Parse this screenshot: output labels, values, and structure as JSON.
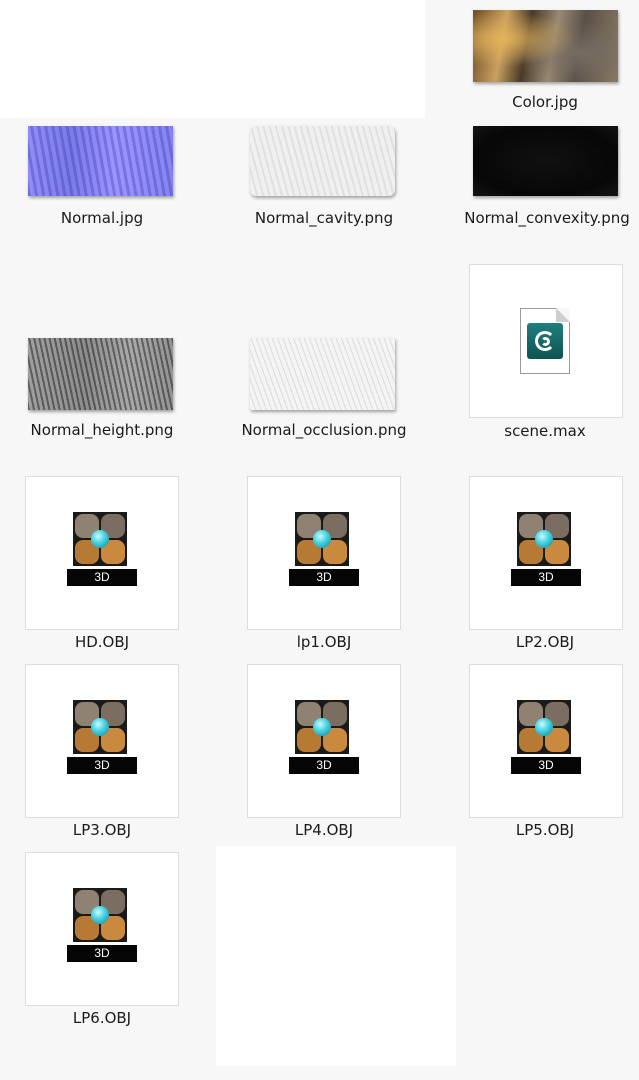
{
  "files": [
    {
      "id": "color",
      "name": "Color.jpg",
      "kind": "image-thumbnail",
      "thumb": "cave-texture"
    },
    {
      "id": "normal",
      "name": "Normal.jpg",
      "kind": "image-thumbnail",
      "thumb": "normal-map"
    },
    {
      "id": "cavity",
      "name": "Normal_cavity.png",
      "kind": "image-thumbnail",
      "thumb": "cavity-map"
    },
    {
      "id": "convexity",
      "name": "Normal_convexity.png",
      "kind": "image-thumbnail",
      "thumb": "convexity-map"
    },
    {
      "id": "height",
      "name": "Normal_height.png",
      "kind": "image-thumbnail",
      "thumb": "height-map"
    },
    {
      "id": "occlusion",
      "name": "Normal_occlusion.png",
      "kind": "image-thumbnail",
      "thumb": "occlusion-map"
    },
    {
      "id": "scene",
      "name": "scene.max",
      "kind": "file-icon",
      "icon": "3ds-max-file-icon"
    },
    {
      "id": "hd",
      "name": "HD.OBJ",
      "kind": "file-icon",
      "icon": "obj-3d-file-icon",
      "badge": "3D"
    },
    {
      "id": "lp1",
      "name": "lp1.OBJ",
      "kind": "file-icon",
      "icon": "obj-3d-file-icon",
      "badge": "3D"
    },
    {
      "id": "lp2",
      "name": "LP2.OBJ",
      "kind": "file-icon",
      "icon": "obj-3d-file-icon",
      "badge": "3D"
    },
    {
      "id": "lp3",
      "name": "LP3.OBJ",
      "kind": "file-icon",
      "icon": "obj-3d-file-icon",
      "badge": "3D"
    },
    {
      "id": "lp4",
      "name": "LP4.OBJ",
      "kind": "file-icon",
      "icon": "obj-3d-file-icon",
      "badge": "3D"
    },
    {
      "id": "lp5",
      "name": "LP5.OBJ",
      "kind": "file-icon",
      "icon": "obj-3d-file-icon",
      "badge": "3D"
    },
    {
      "id": "lp6",
      "name": "LP6.OBJ",
      "kind": "file-icon",
      "icon": "obj-3d-file-icon",
      "badge": "3D"
    }
  ]
}
